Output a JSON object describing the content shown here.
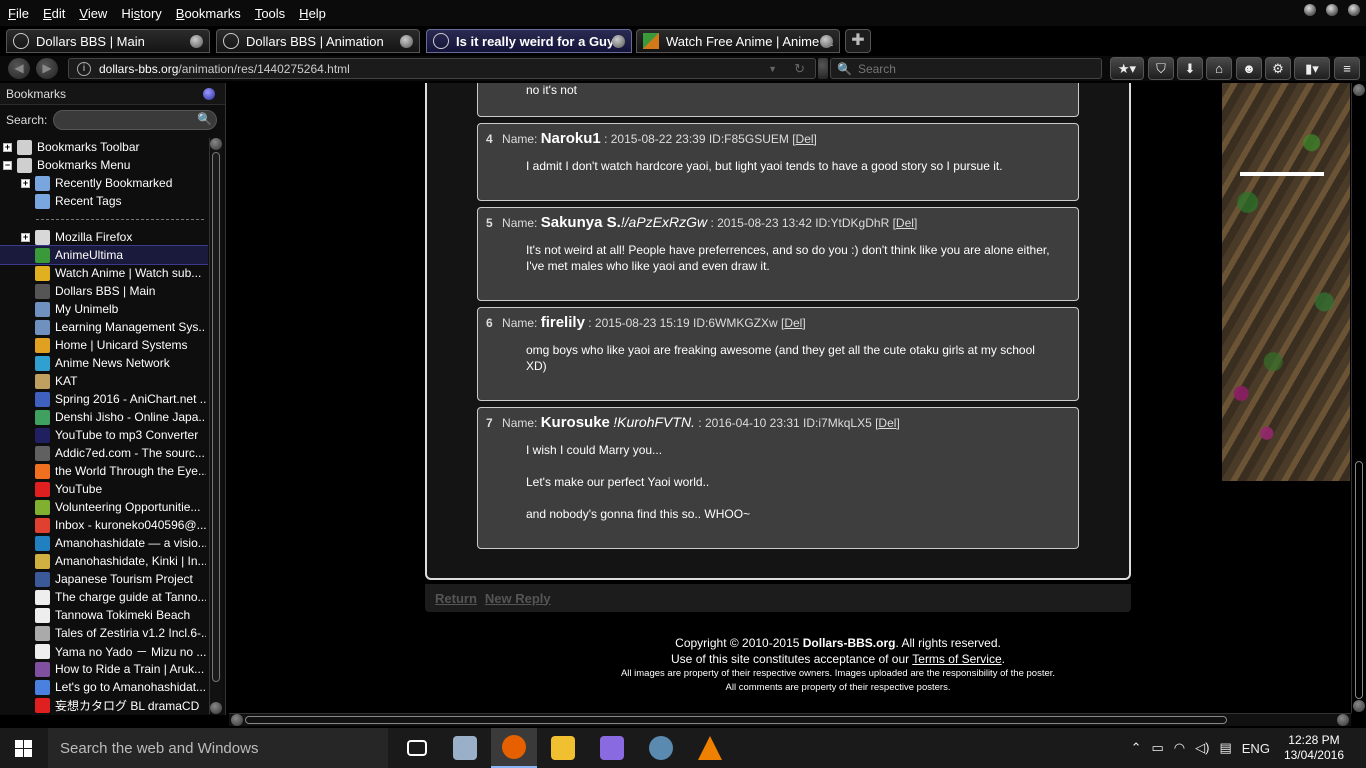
{
  "menubar": {
    "items": [
      "File",
      "Edit",
      "View",
      "History",
      "Bookmarks",
      "Tools",
      "Help"
    ],
    "underline": [
      "F",
      "E",
      "V",
      "s",
      "B",
      "T",
      "H"
    ]
  },
  "tabs": [
    {
      "label": "Dollars BBS | Main",
      "icon": "globe-icon"
    },
    {
      "label": "Dollars BBS | Animation",
      "icon": "globe-icon"
    },
    {
      "label": "Is it really weird for a Guy...",
      "icon": "globe-icon",
      "active": true
    },
    {
      "label": "Watch Free Anime | Anime ...",
      "icon": "anime-favicon"
    }
  ],
  "navbar": {
    "url_host": "dollars-bbs.org",
    "url_path": "/animation/res/1440275264.html",
    "search_placeholder": "Search"
  },
  "sidebar": {
    "title": "Bookmarks",
    "search_label": "Search:",
    "items": [
      {
        "label": "Bookmarks Toolbar",
        "level": 0,
        "twisty": "+",
        "icon": "toolbar-folder-icon",
        "color": "#cfcfcf"
      },
      {
        "label": "Bookmarks Menu",
        "level": 0,
        "twisty": "−",
        "icon": "menu-folder-icon",
        "color": "#cfcfcf"
      },
      {
        "label": "Recently Bookmarked",
        "level": 1,
        "twisty": "+",
        "icon": "query-folder-icon",
        "color": "#7aa6e0"
      },
      {
        "label": "Recent Tags",
        "level": 1,
        "twisty": "",
        "icon": "query-folder-icon",
        "color": "#7aa6e0"
      },
      {
        "label": "",
        "separator": true
      },
      {
        "label": "Mozilla Firefox",
        "level": 1,
        "twisty": "+",
        "icon": "folder-icon",
        "color": "#d8d8d8"
      },
      {
        "label": "AnimeUltima",
        "level": 1,
        "twisty": "",
        "icon": "anime-favicon",
        "color": "#3a9a3a",
        "selected": true
      },
      {
        "label": "Watch Anime | Watch sub...",
        "level": 1,
        "twisty": "",
        "icon": "w-favicon",
        "color": "#e0b020"
      },
      {
        "label": "Dollars BBS | Main",
        "level": 1,
        "twisty": "",
        "icon": "globe-icon",
        "color": "#555555"
      },
      {
        "label": "My Unimelb",
        "level": 1,
        "twisty": "",
        "icon": "unimelb-icon",
        "color": "#7090c0"
      },
      {
        "label": "Learning Management Sys...",
        "level": 1,
        "twisty": "",
        "icon": "unimelb-icon",
        "color": "#7090c0"
      },
      {
        "label": "Home | Unicard Systems",
        "level": 1,
        "twisty": "",
        "icon": "moon-icon",
        "color": "#e0a020"
      },
      {
        "label": "Anime News Network",
        "level": 1,
        "twisty": "",
        "icon": "ann-icon",
        "color": "#30a0d0"
      },
      {
        "label": "KAT",
        "level": 1,
        "twisty": "",
        "icon": "kat-icon",
        "color": "#c0a060"
      },
      {
        "label": "Spring 2016 - AniChart.net ...",
        "level": 1,
        "twisty": "",
        "icon": "anichart-icon",
        "color": "#4060c0"
      },
      {
        "label": "Denshi Jisho - Online Japa...",
        "level": 1,
        "twisty": "",
        "icon": "jisho-icon",
        "color": "#40a060"
      },
      {
        "label": "YouTube to mp3 Converter",
        "level": 1,
        "twisty": "",
        "icon": "converter-icon",
        "color": "#202060"
      },
      {
        "label": "Addic7ed.com - The sourc...",
        "level": 1,
        "twisty": "",
        "icon": "addic7ed-icon",
        "color": "#606060"
      },
      {
        "label": "the World Through the Eye...",
        "level": 1,
        "twisty": "",
        "icon": "blogger-icon",
        "color": "#f07020"
      },
      {
        "label": "YouTube",
        "level": 1,
        "twisty": "",
        "icon": "youtube-icon",
        "color": "#e02020"
      },
      {
        "label": "Volunteering Opportunitie...",
        "level": 1,
        "twisty": "",
        "icon": "volunteer-icon",
        "color": "#80b030"
      },
      {
        "label": "Inbox - kuroneko040596@...",
        "level": 1,
        "twisty": "",
        "icon": "gmail-icon",
        "color": "#e04030"
      },
      {
        "label": "Amanohashidate — a visio...",
        "level": 1,
        "twisty": "",
        "icon": "wordpress-icon",
        "color": "#2080c0"
      },
      {
        "label": "Amanohashidate, Kinki | In...",
        "level": 1,
        "twisty": "",
        "icon": "page-icon",
        "color": "#d0b040"
      },
      {
        "label": "Japanese Tourism Project",
        "level": 1,
        "twisty": "",
        "icon": "facebook-icon",
        "color": "#3b5998"
      },
      {
        "label": "The charge guide at Tanno...",
        "level": 1,
        "twisty": "",
        "icon": "page-icon",
        "color": "#eeeeee"
      },
      {
        "label": "Tannowa Tokimeki Beach",
        "level": 1,
        "twisty": "",
        "icon": "page-icon",
        "color": "#eeeeee"
      },
      {
        "label": "Tales of Zestiria v1.2 Incl.6-...",
        "level": 1,
        "twisty": "",
        "icon": "monitor-icon",
        "color": "#aaaaaa"
      },
      {
        "label": "Yama no Yado － Mizu no ...",
        "level": 1,
        "twisty": "",
        "icon": "page-icon",
        "color": "#eeeeee"
      },
      {
        "label": "How to Ride a Train | Aruk...",
        "level": 1,
        "twisty": "",
        "icon": "train-icon",
        "color": "#8050a0"
      },
      {
        "label": "Let's go to Amanohashidat...",
        "level": 1,
        "twisty": "",
        "icon": "translate-icon",
        "color": "#4a80e0"
      },
      {
        "label": "妄想カタログ BL dramaCD【...",
        "level": 1,
        "twisty": "",
        "icon": "youtube-icon",
        "color": "#e02020"
      }
    ]
  },
  "thread": {
    "prev_body": [
      "no it's not"
    ],
    "posts": [
      {
        "num": "4",
        "name_label": "Name:",
        "name": "Naroku1",
        "trip": "",
        "meta": ": 2015-08-22 23:39 ID:F85GSUEM",
        "del": "Del",
        "body": [
          "I admit I don't watch hardcore yaoi, but light yaoi tends to have a good story so I pursue it."
        ]
      },
      {
        "num": "5",
        "name_label": "Name:",
        "name": "Sakunya S.",
        "trip": "!/aPzExRzGw",
        "meta": ": 2015-08-23 13:42 ID:YtDKgDhR",
        "del": "Del",
        "body": [
          "It's not weird at all! People have preferrences, and so do you :) don't think like you are alone either, I've met males who like yaoi and even draw it."
        ]
      },
      {
        "num": "6",
        "name_label": "Name:",
        "name": "firelily",
        "trip": "",
        "meta": ": 2015-08-23 15:19 ID:6WMKGZXw",
        "del": "Del",
        "body": [
          "omg boys who like yaoi are freaking awesome (and they get all the cute otaku girls at my school XD)"
        ]
      },
      {
        "num": "7",
        "name_label": "Name:",
        "name": "Kurosuke",
        "trip": "!KurohFVTN.",
        "meta": ": 2016-04-10 23:31 ID:i7MkqLX5",
        "del": "Del",
        "body": [
          "I wish I could Marry you...",
          "Let's make our perfect Yaoi world..",
          "and nobody's gonna find this so.. WHOO~"
        ]
      }
    ],
    "links": [
      "Return",
      "New Reply"
    ]
  },
  "footer": {
    "copyright_pre": "Copyright © 2010-2015 ",
    "copyright_site": "Dollars-BBS.org",
    "copyright_post": ". All rights reserved.",
    "use_pre": "Use of this site constitutes acceptance of our ",
    "use_link": "Terms of Service",
    "use_post": ".",
    "images_note": "All images are property of their respective owners. Images uploaded are the responsibility of the poster.",
    "comments_note": "All comments are property of their respective posters."
  },
  "taskbar": {
    "search_placeholder": "Search the web and Windows",
    "apps": [
      {
        "name": "task-view",
        "color": "#ffffff"
      },
      {
        "name": "photos",
        "color": "#9ab0c8"
      },
      {
        "name": "firefox",
        "color": "#e66000",
        "active": true
      },
      {
        "name": "file-explorer",
        "color": "#f0c030"
      },
      {
        "name": "visual-studio",
        "color": "#8a6ae0"
      },
      {
        "name": "steam",
        "color": "#5a8ab0"
      },
      {
        "name": "vlc",
        "color": "#f08000"
      }
    ],
    "language": "ENG",
    "time": "12:28 PM",
    "date": "13/04/2016"
  }
}
